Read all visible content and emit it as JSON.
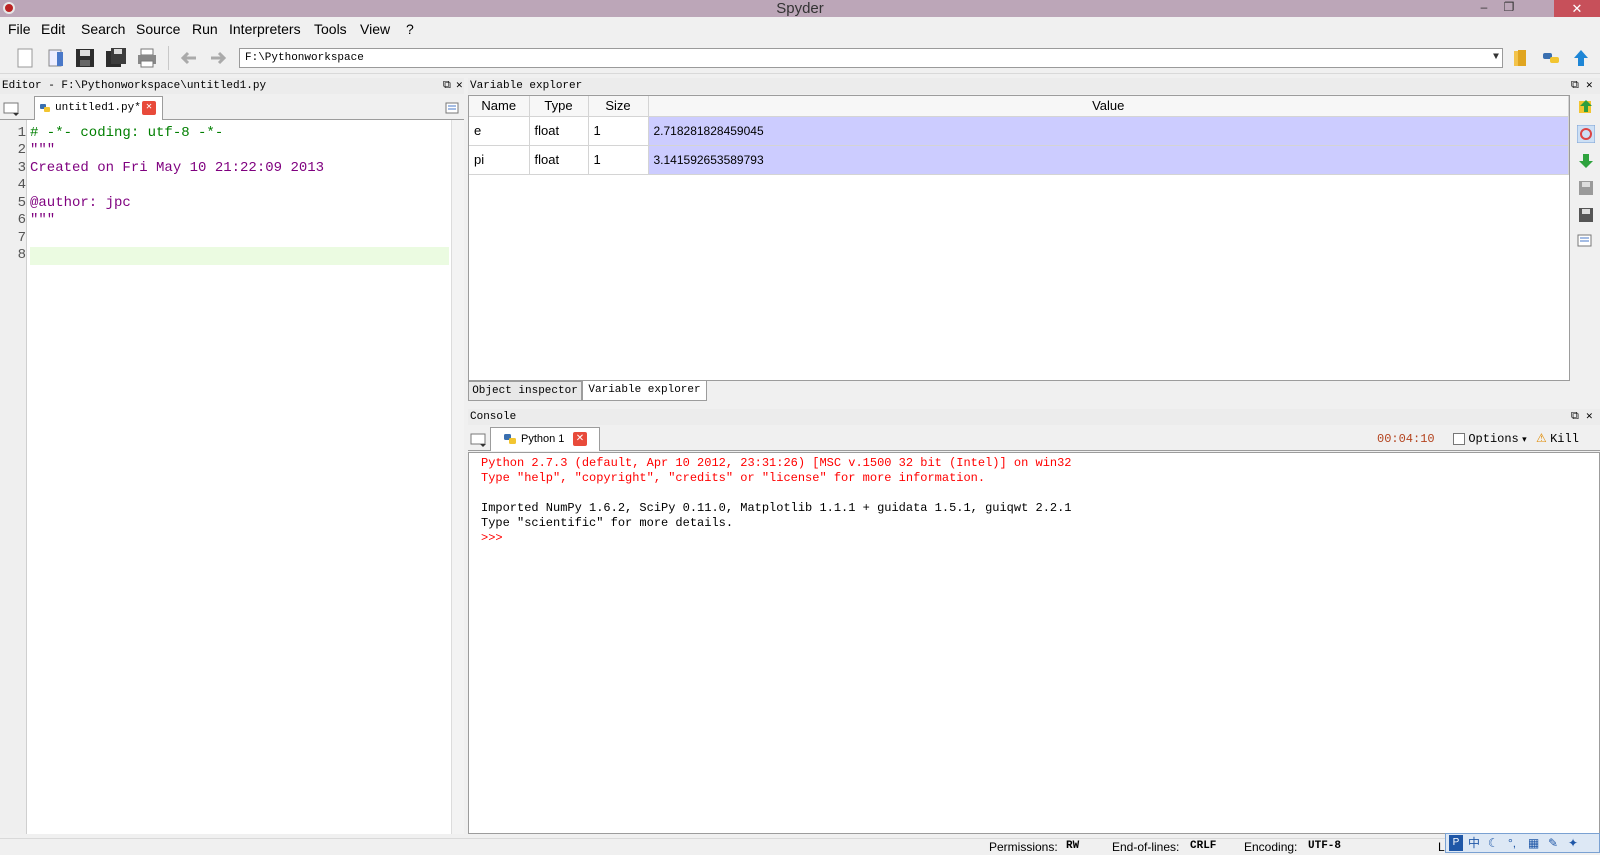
{
  "window": {
    "title": "Spyder",
    "minimize": "–",
    "restore": "❐",
    "close": "✕"
  },
  "menu": [
    "File",
    "Edit",
    "Search",
    "Source",
    "Run",
    "Interpreters",
    "Tools",
    "View",
    "?"
  ],
  "toolbar": {
    "path": "F:\\Pythonworkspace"
  },
  "editor": {
    "header": "Editor - F:\\Pythonworkspace\\untitled1.py",
    "tab_label": "untitled1.py*",
    "lines": [
      {
        "n": "1",
        "text": "# -*- coding: utf-8 -*-",
        "color": "#007f00"
      },
      {
        "n": "2",
        "text": "\"\"\"",
        "color": "#7f007f"
      },
      {
        "n": "3",
        "text": "Created on Fri May 10 21:22:09 2013",
        "color": "#7f007f"
      },
      {
        "n": "4",
        "text": "",
        "color": "#7f007f"
      },
      {
        "n": "5",
        "text": "@author: jpc",
        "color": "#7f007f"
      },
      {
        "n": "6",
        "text": "\"\"\"",
        "color": "#7f007f"
      },
      {
        "n": "7",
        "text": "",
        "color": "#000000"
      },
      {
        "n": "8",
        "text": "",
        "color": "#000000"
      }
    ]
  },
  "variable_explorer": {
    "header": "Variable explorer",
    "columns": [
      "Name",
      "Type",
      "Size",
      "Value"
    ],
    "rows": [
      {
        "name": "e",
        "type": "float",
        "size": "1",
        "value": "2.718281828459045"
      },
      {
        "name": "pi",
        "type": "float",
        "size": "1",
        "value": "3.141592653589793"
      }
    ],
    "tabs": [
      "Object inspector",
      "Variable explorer"
    ]
  },
  "console": {
    "header": "Console",
    "tab_label": "Python 1",
    "timer": "00:04:10",
    "options_label": "Options",
    "kill_label": "Kill",
    "lines": [
      {
        "text": "Python 2.7.3 (default, Apr 10 2012, 23:31:26) [MSC v.1500 32 bit (Intel)] on win32",
        "color": "#ff0000"
      },
      {
        "text": "Type \"help\", \"copyright\", \"credits\" or \"license\" for more information.",
        "color": "#ff0000"
      },
      {
        "text": "",
        "color": "#000000"
      },
      {
        "text": "Imported NumPy 1.6.2, SciPy 0.11.0, Matplotlib 1.1.1 + guidata 1.5.1, guiqwt 2.2.1",
        "color": "#000000"
      },
      {
        "text": "Type \"scientific\" for more details.",
        "color": "#000000"
      },
      {
        "text": ">>> ",
        "color": "#ff0000"
      }
    ]
  },
  "statusbar": {
    "permissions_label": "Permissions:",
    "permissions_value": "RW",
    "eol_label": "End-of-lines:",
    "eol_value": "CRLF",
    "encoding_label": "Encoding:",
    "encoding_value": "UTF-8",
    "trailing": "L"
  },
  "ime": {
    "text": "中"
  },
  "colors": {
    "titlebar": "#bca6b8",
    "selected_value": "#ccccff",
    "current_line": "#ebfbe1",
    "close_button": "#c7505a"
  }
}
